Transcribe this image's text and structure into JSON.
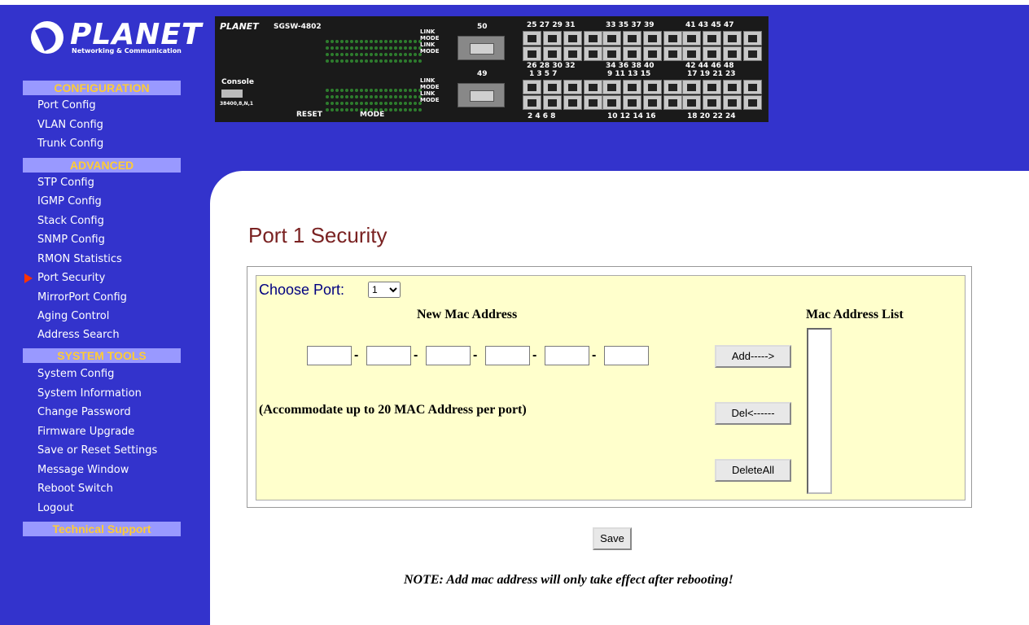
{
  "logo": {
    "brand": "PLANET",
    "tagline": "Networking & Communication"
  },
  "sidebar": {
    "sections": [
      {
        "header": "CONFIGURATION",
        "items": [
          "Port Config",
          "VLAN Config",
          "Trunk Config"
        ]
      },
      {
        "header": "ADVANCED",
        "items": [
          "STP Config",
          "IGMP Config",
          "Stack Config",
          "SNMP Config",
          "RMON Statistics",
          "Port Security",
          "MirrorPort Config",
          "Aging Control",
          "Address Search"
        ]
      },
      {
        "header": "SYSTEM TOOLS",
        "items": [
          "System Config",
          "System Information",
          "Change Password",
          "Firmware Upgrade",
          "Save or Reset Settings",
          "Message Window",
          "Reboot Switch",
          "Logout"
        ]
      },
      {
        "header": "Technical Support",
        "items": []
      }
    ],
    "active_item": "Port Security"
  },
  "device": {
    "brand": "PLANET",
    "model": "SGSW-4802",
    "console_label": "Console",
    "console_setting": "38400,8,N,1",
    "reset_label": "RESET",
    "mode_label": "MODE",
    "led_labels": [
      "LINK",
      "MODE",
      "LINK",
      "MODE",
      "LINK",
      "MODE",
      "LINK",
      "MODE"
    ],
    "sfp_top": "50",
    "sfp_bottom": "49",
    "top_row_top_labels": [
      "25 27 29 31",
      "33 35 37 39",
      "41 43 45 47"
    ],
    "top_row_bottom_labels": [
      "26 28 30 32",
      "34 36 38 40",
      "42 44 46 48"
    ],
    "bottom_row_top_labels": [
      "1  3  5  7",
      "9  11 13 15",
      "17 19 21 23"
    ],
    "bottom_row_bottom_labels": [
      "2  4  6  8",
      "10 12 14 16",
      "18 20 22 24"
    ]
  },
  "page": {
    "title": "Port 1 Security",
    "choose_port_label": "Choose Port:",
    "port_selected": "1",
    "new_mac_label": "New Mac Address",
    "mac_list_label": "Mac Address List",
    "mac_fields": [
      "",
      "",
      "",
      "",
      "",
      ""
    ],
    "separator": "-",
    "limit_note": "(Accommodate up to 20 MAC Address per port)",
    "add_button": "Add----->",
    "del_button": "Del<------",
    "delete_all_button": "DeleteAll",
    "save_button": "Save",
    "reboot_note": "NOTE: Add mac address will only take effect after rebooting!"
  }
}
